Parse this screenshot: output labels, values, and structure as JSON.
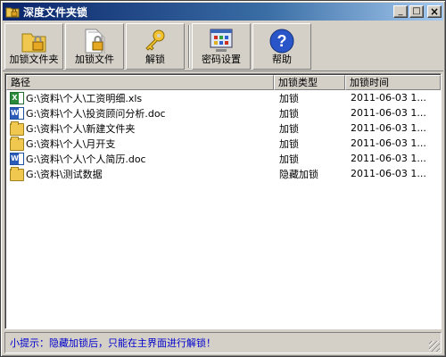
{
  "window": {
    "title": "深度文件夹锁",
    "minimize": "_",
    "maximize": "□",
    "close": "×"
  },
  "toolbar": {
    "lock_folder": "加锁文件夹",
    "lock_file": "加锁文件",
    "unlock": "解锁",
    "password_settings": "密码设置",
    "help": "帮助"
  },
  "list": {
    "columns": [
      "路径",
      "加锁类型",
      "加锁时间"
    ],
    "rows": [
      {
        "icon": "xls",
        "path": "G:\\资料\\个人\\工资明细.xls",
        "type": "加锁",
        "time": "2011-06-03 1..."
      },
      {
        "icon": "doc",
        "path": "G:\\资料\\个人\\投资顾问分析.doc",
        "type": "加锁",
        "time": "2011-06-03 1..."
      },
      {
        "icon": "folder",
        "path": "G:\\资料\\个人\\新建文件夹",
        "type": "加锁",
        "time": "2011-06-03 1..."
      },
      {
        "icon": "folder",
        "path": "G:\\资料\\个人\\月开支",
        "type": "加锁",
        "time": "2011-06-03 1..."
      },
      {
        "icon": "doc",
        "path": "G:\\资料\\个人\\个人简历.doc",
        "type": "加锁",
        "time": "2011-06-03 1..."
      },
      {
        "icon": "folder",
        "path": "G:\\资料\\测试数据",
        "type": "隐藏加锁",
        "time": "2011-06-03 1..."
      }
    ]
  },
  "status": {
    "tip": "小提示：隐藏加锁后，只能在主界面进行解锁！"
  },
  "colors": {
    "titlebar_start": "#0a246a",
    "titlebar_end": "#a6caf0",
    "status_text": "#0000cc",
    "face": "#d4d0c8"
  }
}
